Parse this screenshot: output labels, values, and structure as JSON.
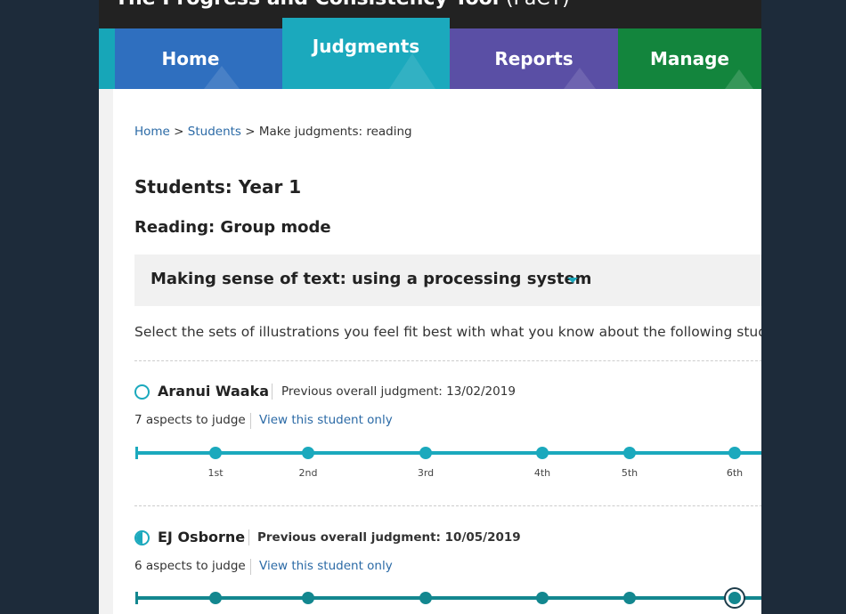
{
  "app": {
    "title": "The Progress and Consistency Tool",
    "abbr": "(PaCT)"
  },
  "nav": {
    "tabs": [
      {
        "label": "Home"
      },
      {
        "label": "Judgments"
      },
      {
        "label": "Reports"
      },
      {
        "label": "Manage"
      }
    ],
    "active": "Judgments"
  },
  "breadcrumb": {
    "home": "Home",
    "sep1": " > ",
    "students": "Students",
    "sep2": " > ",
    "current": "Make judgments: reading"
  },
  "page": {
    "students_heading": "Students: Year 1",
    "subject_heading": "Reading: Group mode"
  },
  "aspect_select": {
    "value": "Making sense of text: using a processing system"
  },
  "instructions": "Select the sets of illustrations you feel fit best with what you know about the following students",
  "scale_ticks": [
    "1st",
    "2nd",
    "3rd",
    "4th",
    "5th",
    "6th"
  ],
  "students": [
    {
      "name": "Aranui Waaka",
      "status": "not-started",
      "previous": "Previous overall judgment: 13/02/2019",
      "aspects": "7 aspects to judge",
      "view_link": "View this student only"
    },
    {
      "name": "EJ Osborne",
      "status": "in-progress",
      "previous": "Previous overall judgment: 10/05/2019",
      "aspects": "6 aspects to judge",
      "view_link": "View this student only",
      "selected_point": 7
    }
  ],
  "colors": {
    "background": "#1d2b3a",
    "topbar": "#222222",
    "home_tab": "#2f6fbf",
    "judgments_tab": "#1ba9bd",
    "reports_tab": "#5a4fa5",
    "manage_tab": "#13853d",
    "link": "#2b6aa6",
    "scale": "#1ba9bd"
  }
}
